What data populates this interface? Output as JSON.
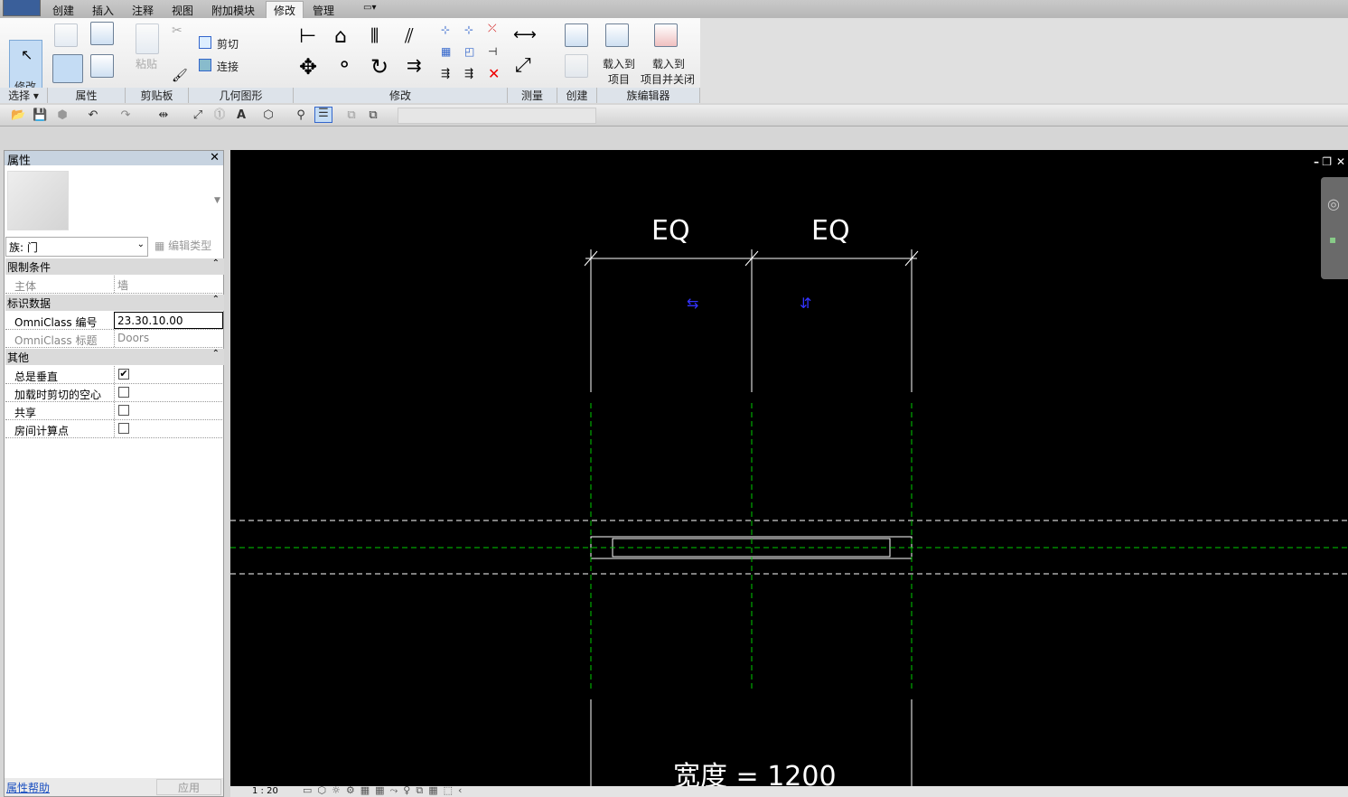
{
  "tabs": [
    "创建",
    "插入",
    "注释",
    "视图",
    "附加模块",
    "修改",
    "管理"
  ],
  "active_tab": "修改",
  "ribbon": {
    "modify_label": "修改",
    "cut_label": "剪切",
    "join_label": "连接",
    "paste_label": "粘贴",
    "load_project": [
      "载入到",
      "项目"
    ],
    "load_close": [
      "载入到",
      "项目并关闭"
    ],
    "panels": [
      "选择 ▾",
      "属性",
      "剪贴板",
      "几何图形",
      "修改",
      "测量",
      "创建",
      "族编辑器"
    ]
  },
  "properties": {
    "title": "属性",
    "close": "✕",
    "type_selector": "族: 门",
    "edit_type": "编辑类型",
    "sections": [
      {
        "name": "限制条件",
        "rows": [
          {
            "key": "主体",
            "value": "墙"
          }
        ]
      },
      {
        "name": "标识数据",
        "rows": [
          {
            "key": "OmniClass 编号",
            "value": "23.30.10.00"
          },
          {
            "key": "OmniClass 标题",
            "value": "Doors"
          }
        ]
      },
      {
        "name": "其他",
        "rows": [
          {
            "key": "总是垂直",
            "checked": true
          },
          {
            "key": "加载时剪切的空心",
            "checked": false
          },
          {
            "key": "共享",
            "checked": false
          },
          {
            "key": "房间计算点",
            "checked": false
          }
        ]
      }
    ],
    "help_link": "属性帮助",
    "apply": "应用"
  },
  "canvas": {
    "dim_left": "EQ",
    "dim_right": "EQ",
    "width_label": "宽度 = 1200"
  },
  "status": {
    "scale": "1 : 20"
  }
}
